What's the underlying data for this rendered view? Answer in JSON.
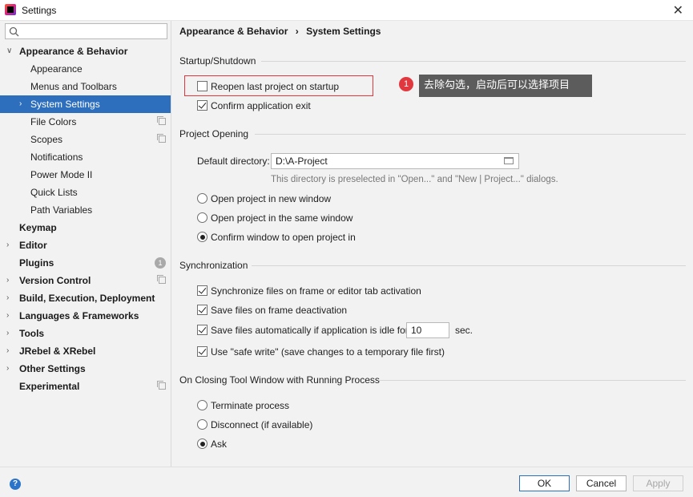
{
  "window": {
    "title": "Settings",
    "close_glyph": "✕"
  },
  "sidebar": {
    "search_placeholder": "",
    "items": [
      {
        "label": "Appearance & Behavior",
        "level": 0,
        "expanded": true
      },
      {
        "label": "Appearance",
        "level": 1
      },
      {
        "label": "Menus and Toolbars",
        "level": 1
      },
      {
        "label": "System Settings",
        "level": 1,
        "selected": true
      },
      {
        "label": "File Colors",
        "level": 1
      },
      {
        "label": "Scopes",
        "level": 1
      },
      {
        "label": "Notifications",
        "level": 1
      },
      {
        "label": "Power Mode II",
        "level": 1
      },
      {
        "label": "Quick Lists",
        "level": 1
      },
      {
        "label": "Path Variables",
        "level": 1
      },
      {
        "label": "Keymap",
        "level": 0
      },
      {
        "label": "Editor",
        "level": 0
      },
      {
        "label": "Plugins",
        "level": 0,
        "badge": "1"
      },
      {
        "label": "Version Control",
        "level": 0
      },
      {
        "label": "Build, Execution, Deployment",
        "level": 0
      },
      {
        "label": "Languages & Frameworks",
        "level": 0
      },
      {
        "label": "Tools",
        "level": 0
      },
      {
        "label": "JRebel & XRebel",
        "level": 0
      },
      {
        "label": "Other Settings",
        "level": 0
      },
      {
        "label": "Experimental",
        "level": 0
      }
    ]
  },
  "breadcrumb": {
    "parent": "Appearance & Behavior",
    "separator": "›",
    "current": "System Settings"
  },
  "startup": {
    "title": "Startup/Shutdown",
    "reopen_label": "Reopen last project on startup",
    "reopen_checked": false,
    "confirm_exit_label": "Confirm application exit",
    "confirm_exit_checked": true
  },
  "project_opening": {
    "title": "Project Opening",
    "default_dir_label": "Default directory:",
    "default_dir_value": "D:\\A-Project",
    "hint": "This directory is preselected in \"Open...\" and \"New | Project...\" dialogs.",
    "options": [
      "Open project in new window",
      "Open project in the same window",
      "Confirm window to open project in"
    ],
    "selected": 2
  },
  "sync": {
    "title": "Synchronization",
    "sync_files_label": "Synchronize files on frame or editor tab activation",
    "save_deactivation_label": "Save files on frame deactivation",
    "save_idle_label": "Save files automatically if application is idle for",
    "idle_value": "10",
    "idle_unit": "sec.",
    "safe_write_label": "Use \"safe write\" (save changes to a temporary file first)"
  },
  "closing": {
    "title": "On Closing Tool Window with Running Process",
    "options": [
      "Terminate process",
      "Disconnect (if available)",
      "Ask"
    ],
    "selected": 2
  },
  "annotation": {
    "number": "1",
    "text": "去除勾选，启动后可以选择项目",
    "color": "#e0383e"
  },
  "buttons": {
    "help": "?",
    "ok": "OK",
    "cancel": "Cancel",
    "apply": "Apply"
  },
  "colors": {
    "selection": "#2e6fbd",
    "accent": "#2a74c9"
  }
}
